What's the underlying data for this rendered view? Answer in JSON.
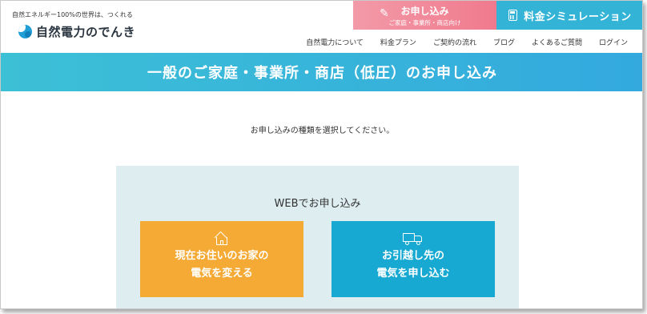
{
  "header": {
    "tagline": "自然エネルギー100%の世界は、つくれる",
    "logo_text": "自然電力のでんき"
  },
  "cta": {
    "apply_main": "お申し込み",
    "apply_sub": "ご家庭・事業所・商店向け",
    "simulation": "料金シミュレーション"
  },
  "nav": [
    {
      "label": "自然電力について"
    },
    {
      "label": "料金プラン"
    },
    {
      "label": "ご契約の流れ"
    },
    {
      "label": "ブログ"
    },
    {
      "label": "よくあるご質問"
    },
    {
      "label": "ログイン"
    }
  ],
  "banner": {
    "title": "一般のご家庭・事業所・商店（低圧）のお申し込み"
  },
  "main": {
    "instruction": "お申し込みの種類を選択してください。",
    "web_panel": {
      "title": "WEBでお申し込み",
      "options": [
        {
          "line1": "現在お住いのお家の",
          "line2": "電気を変える",
          "icon": "house-icon",
          "color": "#f4aa35"
        },
        {
          "line1": "お引越し先の",
          "line2": "電気を申し込む",
          "icon": "truck-icon",
          "color": "#17a9d2"
        }
      ]
    }
  },
  "colors": {
    "apply_pink": "#f07a8d",
    "simulation_blue": "#33b4d6",
    "banner_teal": "#3cc0d6",
    "panel_bg": "#deedf0"
  }
}
